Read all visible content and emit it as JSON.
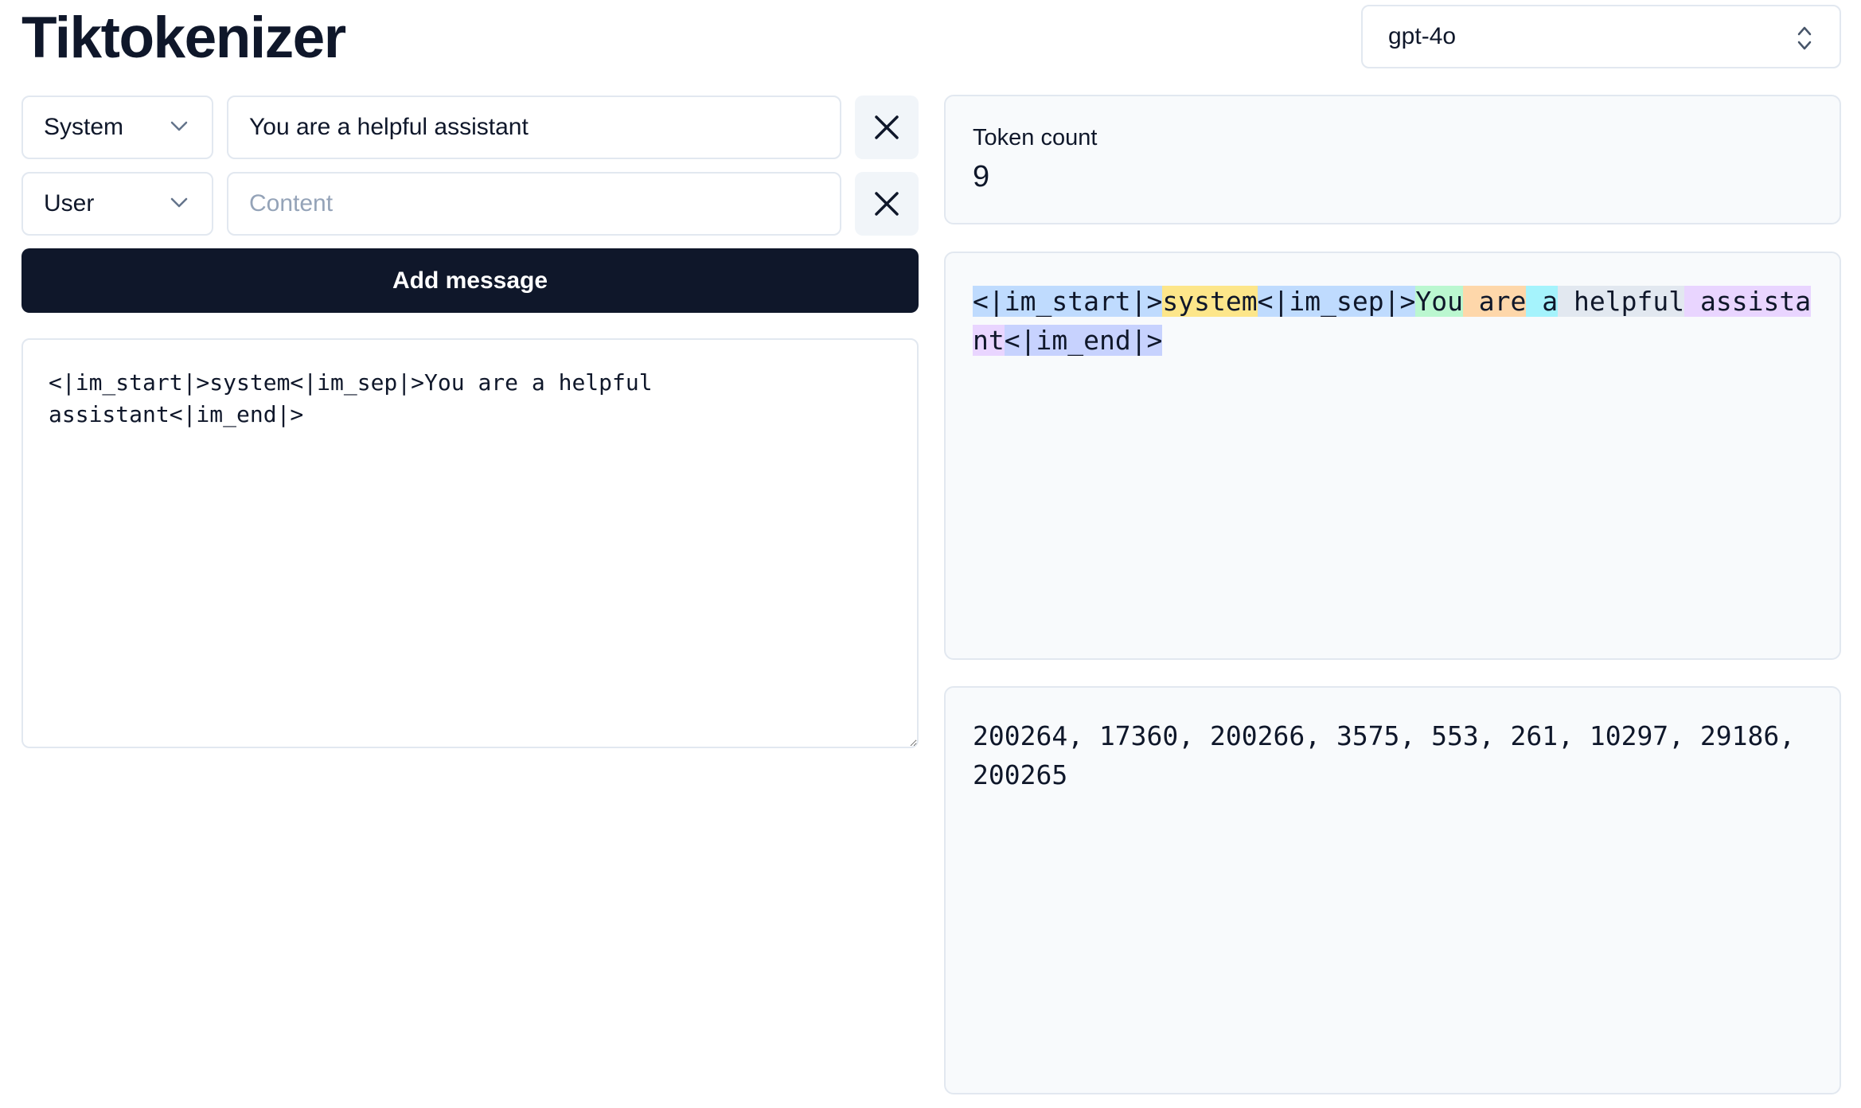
{
  "app": {
    "title": "Tiktokenizer"
  },
  "model_select": {
    "value": "gpt-4o"
  },
  "messages": [
    {
      "role": "System",
      "content": "You are a helpful assistant",
      "placeholder": "Content"
    },
    {
      "role": "User",
      "content": "",
      "placeholder": "Content"
    }
  ],
  "add_message_label": "Add message",
  "raw_text": "<|im_start|>system<|im_sep|>You are a helpful assistant<|im_end|>",
  "token_count": {
    "label": "Token count",
    "value": "9"
  },
  "tokens": [
    {
      "text": "<|im_start|>",
      "color": "#bfdbfe"
    },
    {
      "text": "system",
      "color": "#fde68a"
    },
    {
      "text": "<|im_sep|>",
      "color": "#bfdbfe"
    },
    {
      "text": "You",
      "color": "#bbf7d0"
    },
    {
      "text": " are",
      "color": "#fed7aa"
    },
    {
      "text": " a",
      "color": "#a5f3fc"
    },
    {
      "text": " helpful",
      "color": "#e2e8f0"
    },
    {
      "text": " assistant",
      "color": "#e9d5ff"
    },
    {
      "text": "<|im_end|>",
      "color": "#c7d2fe"
    }
  ],
  "token_ids": "200264, 17360, 200266, 3575, 553, 261, 10297, 29186, 200265"
}
